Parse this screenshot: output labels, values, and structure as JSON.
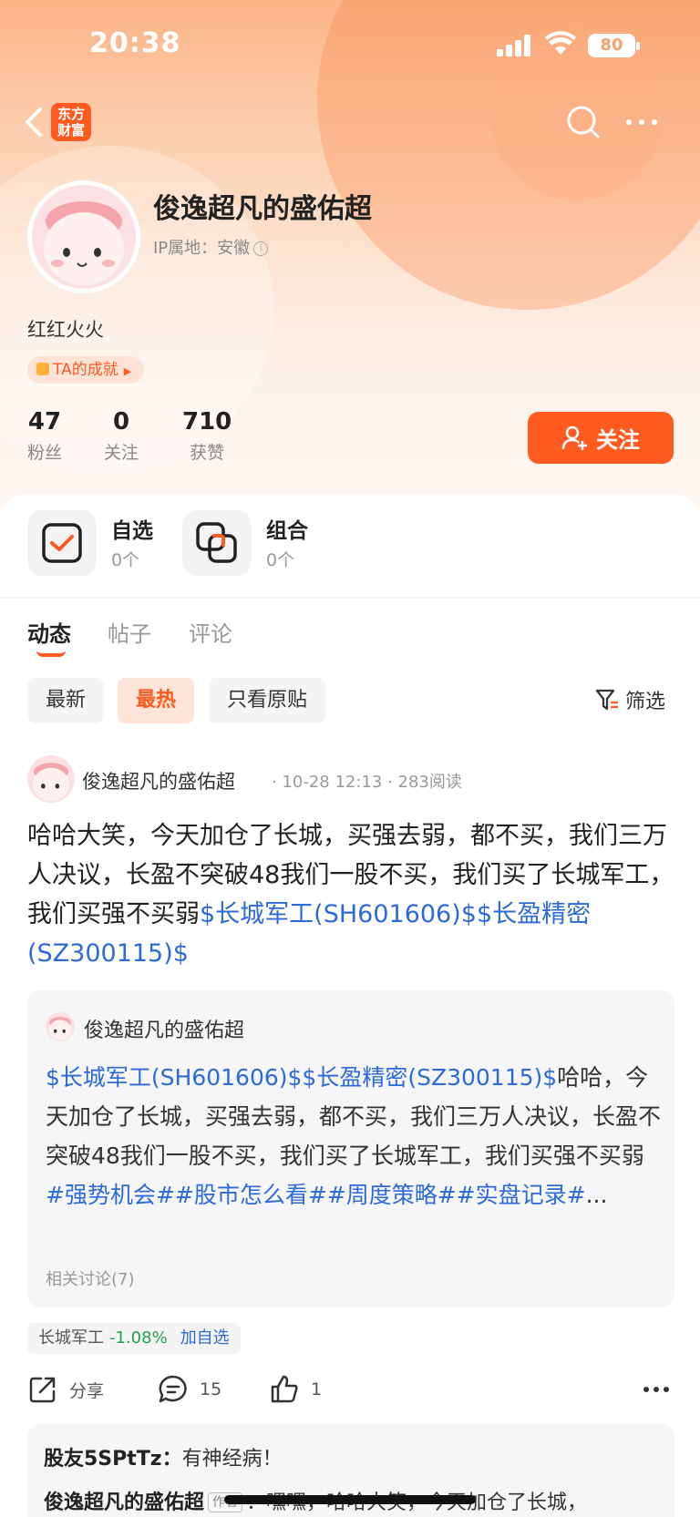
{
  "status_bar": {
    "time": "20:38",
    "battery": "80"
  },
  "nav": {
    "logo_line1": "东方",
    "logo_line2": "财富"
  },
  "profile": {
    "name": "俊逸超凡的盛佑超",
    "ip_label": "IP属地：安徽",
    "bio": "红红火火",
    "achievement": "TA的成就",
    "stats": [
      {
        "value": "47",
        "label": "粉丝"
      },
      {
        "value": "0",
        "label": "关注"
      },
      {
        "value": "710",
        "label": "获赞"
      }
    ],
    "follow_label": "关注"
  },
  "watch": {
    "self_title": "自选",
    "self_count": "0个",
    "combo_title": "组合",
    "combo_count": "0个"
  },
  "tabs": [
    "动态",
    "帖子",
    "评论"
  ],
  "filters": [
    "最新",
    "最热",
    "只看原贴"
  ],
  "filter_btn": "筛选",
  "post": {
    "author": "俊逸超凡的盛佑超",
    "meta": "· 10-28 12:13 · 283阅读",
    "text": "哈哈大笑，今天加仓了长城，买强去弱，都不买，我们三万人决议，长盈不突破48我们一股不买，我们买了长城军工，我们买强不买弱",
    "link1": "$长城军工(SH601606)$",
    "link2": "$长盈精密(SZ300115)$",
    "quote": {
      "author": "俊逸超凡的盛佑超",
      "links": "$长城军工(SH601606)$$长盈精密(SZ300115)$",
      "text": "哈哈，今天加仓了长城，买强去弱，都不买，我们三万人决议，长盈不突破48我们一股不买，我们买了长城军工，我们买强不买弱",
      "tags": "#强势机会##股市怎么看##周度策略##实盘记录#",
      "ellipsis": "...",
      "related": "相关讨论(7)"
    },
    "stock": {
      "name": "长城军工",
      "change": "-1.08%",
      "add": "加自选"
    },
    "actions": {
      "share": "分享",
      "comments": "15",
      "likes": "1"
    }
  },
  "comments": [
    {
      "user": "股友5SPtTz：",
      "text": "有神经病！"
    },
    {
      "user": "俊逸超凡的盛佑超",
      "tag": "作者",
      "text": "：嘿嘿，哈哈大笑，今天加仓了长城，"
    }
  ],
  "colors": {
    "accent": "#ff5a1f",
    "link": "#2d6ad9",
    "down": "#1fa34a"
  }
}
